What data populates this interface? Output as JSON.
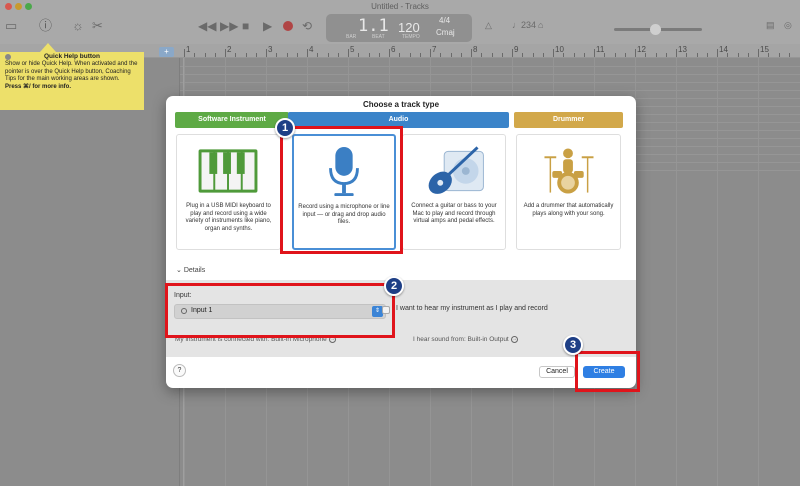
{
  "window": {
    "title": "Untitled - Tracks"
  },
  "toolbar": {
    "lcd_position": "1.1",
    "lcd_bar_label": "BAR",
    "lcd_beat_label": "BEAT",
    "lcd_tempo": "120",
    "lcd_tempo_label": "TEMPO",
    "lcd_time_signature": "4/4",
    "lcd_key": "Cmaj",
    "count_in": "♩234",
    "tuner": "△"
  },
  "ruler": {
    "bars": [
      "1",
      "2",
      "3",
      "4",
      "5",
      "6",
      "7",
      "8",
      "9",
      "10",
      "11",
      "12",
      "13",
      "14",
      "15"
    ],
    "add_track_label": "+"
  },
  "quick_help": {
    "title": "Quick Help button",
    "body": "Show or hide Quick Help. When activated and the pointer is over the Quick Help button, Coaching Tips for the main working areas are shown.",
    "more": "Press ⌘/ for more info."
  },
  "dialog": {
    "title": "Choose a track type",
    "tabs": {
      "software_instrument": "Software Instrument",
      "audio": "Audio",
      "drummer": "Drummer"
    },
    "cards": {
      "software_instrument": "Plug in a USB MIDI keyboard to play and record using a wide variety of instruments like piano, organ and synths.",
      "microphone": "Record using a microphone or line input — or drag and drop audio files.",
      "guitar": "Connect a guitar or bass to your Mac to play and record through virtual amps and pedal effects.",
      "drummer": "Add a drummer that automatically plays along with your song."
    },
    "details_label": "Details",
    "input_label": "Input:",
    "input_value": "Input 1",
    "monitor_label": "I want to hear my instrument as I play and record",
    "connected_with": "My instrument is connected with: Built-in Microphone",
    "hear_from": "I hear sound from: Built-in Output",
    "help_label": "?",
    "cancel_label": "Cancel",
    "create_label": "Create"
  },
  "callouts": {
    "one": "1",
    "two": "2",
    "three": "3"
  },
  "colors": {
    "software_tab": "#5eaa45",
    "audio_tab": "#3b84c9",
    "drummer_tab": "#d2a84a",
    "create_button": "#2f7fe3",
    "callout_border": "#e0141b",
    "badge": "#1e3f86",
    "quick_help_bg": "#ede06a"
  }
}
